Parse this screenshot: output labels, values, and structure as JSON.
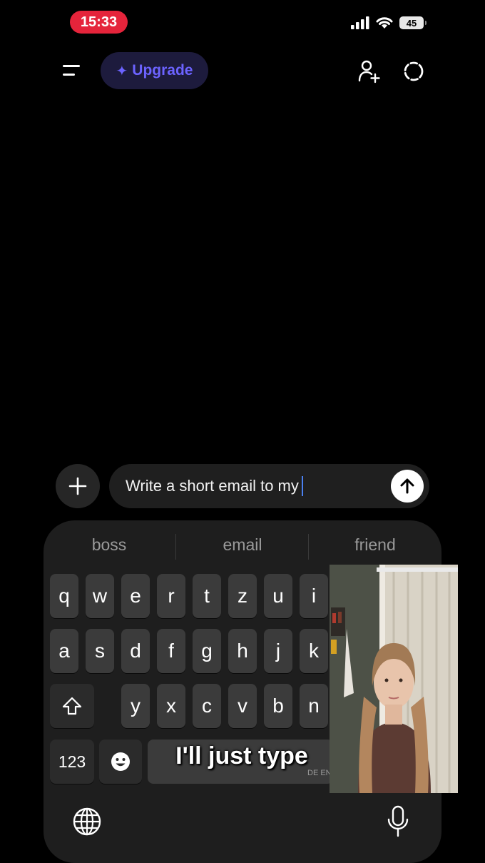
{
  "status_bar": {
    "time": "15:33",
    "battery": "45"
  },
  "header": {
    "upgrade_label": "Upgrade",
    "upgrade_icon": "sparkle-icon"
  },
  "composer": {
    "text": "Write a short email to my"
  },
  "keyboard": {
    "suggestions": [
      "boss",
      "email",
      "friend"
    ],
    "row1": [
      "q",
      "w",
      "e",
      "r",
      "t",
      "z",
      "u",
      "i"
    ],
    "row2": [
      "a",
      "s",
      "d",
      "f",
      "g",
      "h",
      "j",
      "k"
    ],
    "row3": [
      "y",
      "x",
      "c",
      "v",
      "b",
      "n"
    ],
    "numbers_key": "123",
    "space_language": "DE EN"
  },
  "video_caption": "I'll just type",
  "colors": {
    "accent": "#6c63ff",
    "time_pill": "#e5243b",
    "caret": "#4a80f0"
  }
}
